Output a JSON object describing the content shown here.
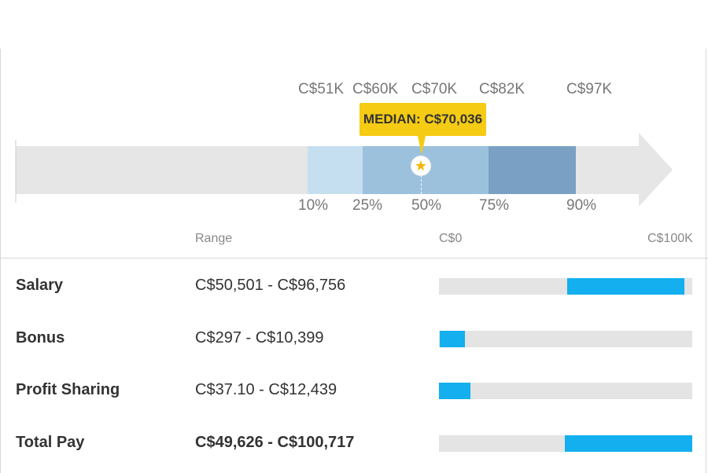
{
  "chart_data": [
    {
      "type": "bar",
      "description_type": "percentile range",
      "top_labels": [
        "C$51K",
        "C$60K",
        "C$70K",
        "C$82K",
        "C$97K"
      ],
      "percentile_labels": [
        "10%",
        "25%",
        "50%",
        "75%",
        "90%"
      ],
      "percentiles": [
        {
          "percentile": 10,
          "value": 51000
        },
        {
          "percentile": 25,
          "value": 60000
        },
        {
          "percentile": 50,
          "value": 70000
        },
        {
          "percentile": 75,
          "value": 82000
        },
        {
          "percentile": 90,
          "value": 97000
        }
      ],
      "median_label": "MEDIAN: C$70,036",
      "median_value": 70036,
      "colors": {
        "p10_p25": "#c5dff0",
        "p25_p75": "#9cc1dd",
        "p75_p90": "#7aa1c3",
        "track": "#e6e6e6"
      }
    },
    {
      "type": "bar",
      "description_type": "range bars",
      "column_headers": {
        "range": "Range",
        "axis_min": "C$0",
        "axis_max": "C$100K"
      },
      "xlim": [
        0,
        100000
      ],
      "rows": [
        {
          "label": "Salary",
          "range_text": "C$50,501 - C$96,756",
          "low": 50501,
          "high": 96756,
          "bold_range": false
        },
        {
          "label": "Bonus",
          "range_text": "C$297 - C$10,399",
          "low": 297,
          "high": 10399,
          "bold_range": false
        },
        {
          "label": "Profit Sharing",
          "range_text": "C$37.10 - C$12,439",
          "low": 37.1,
          "high": 12439,
          "bold_range": false
        },
        {
          "label": "Total Pay",
          "range_text": "C$49,626 - C$100,717",
          "low": 49626,
          "high": 100717,
          "bold_range": true
        }
      ],
      "colors": {
        "fill": "#13afee",
        "track": "#e4e4e4"
      }
    }
  ]
}
